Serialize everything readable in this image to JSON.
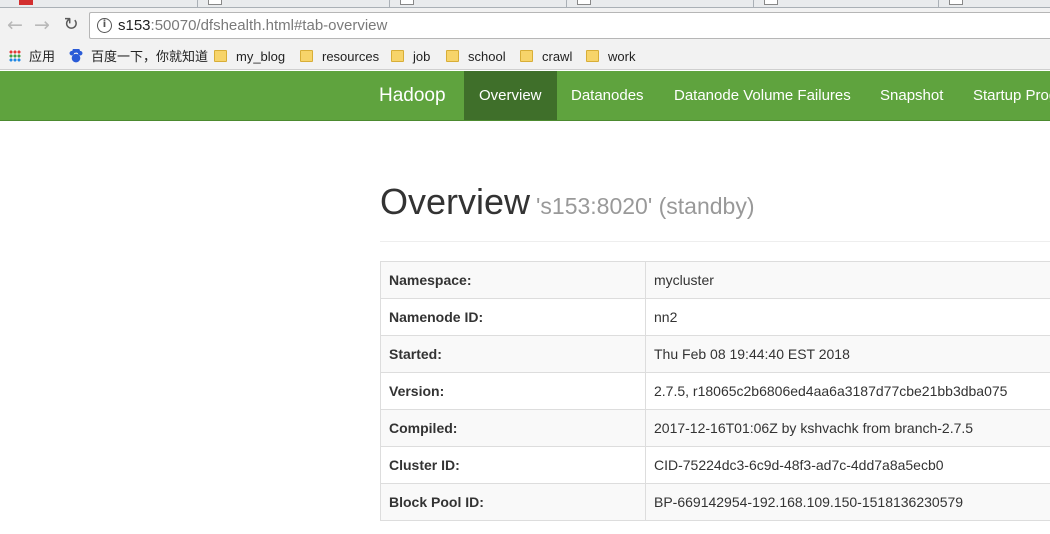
{
  "browser": {
    "url_host": "s153",
    "url_rest": ":50070/dfshealth.html#tab-overview"
  },
  "bookmarks": [
    {
      "label": "应用",
      "icon": "apps-icon"
    },
    {
      "label": "百度一下，你就知道",
      "icon": "baidu-icon"
    },
    {
      "label": "my_blog",
      "icon": "folder-icon"
    },
    {
      "label": "resources",
      "icon": "folder-icon"
    },
    {
      "label": "job",
      "icon": "folder-icon"
    },
    {
      "label": "school",
      "icon": "folder-icon"
    },
    {
      "label": "crawl",
      "icon": "folder-icon"
    },
    {
      "label": "work",
      "icon": "folder-icon"
    }
  ],
  "navbar": {
    "brand": "Hadoop",
    "items": [
      {
        "label": "Overview",
        "active": true
      },
      {
        "label": "Datanodes"
      },
      {
        "label": "Datanode Volume Failures"
      },
      {
        "label": "Snapshot"
      },
      {
        "label": "Startup Progress"
      }
    ],
    "color": "#5fa33e",
    "active_color": "#3f6f2a"
  },
  "overview": {
    "title": "Overview",
    "subtitle": "'s153:8020' (standby)",
    "rows": [
      {
        "key": "Namespace:",
        "value": "mycluster"
      },
      {
        "key": "Namenode ID:",
        "value": "nn2"
      },
      {
        "key": "Started:",
        "value": "Thu Feb 08 19:44:40 EST 2018"
      },
      {
        "key": "Version:",
        "value": "2.7.5, r18065c2b6806ed4aa6a3187d77cbe21bb3dba075"
      },
      {
        "key": "Compiled:",
        "value": "2017-12-16T01:06Z by kshvachk from branch-2.7.5"
      },
      {
        "key": "Cluster ID:",
        "value": "CID-75224dc3-6c9d-48f3-ad7c-4dd7a8a5ecb0"
      },
      {
        "key": "Block Pool ID:",
        "value": "BP-669142954-192.168.109.150-1518136230579"
      }
    ]
  }
}
